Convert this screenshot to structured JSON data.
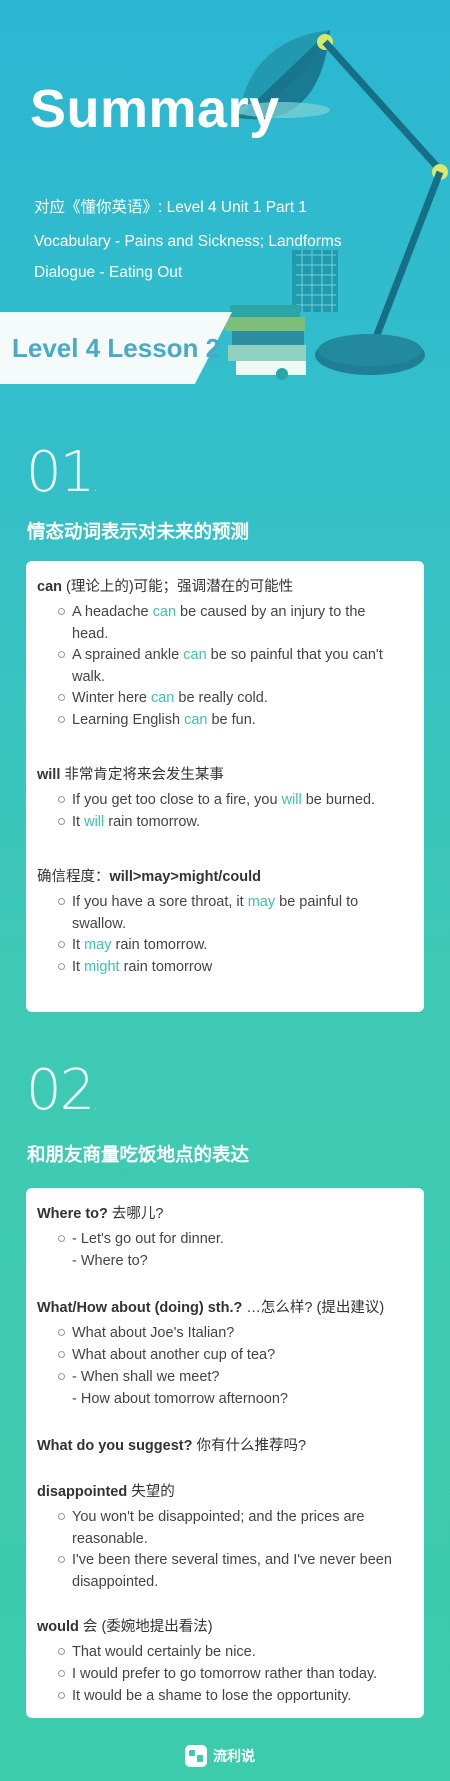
{
  "header": {
    "title": "Summary",
    "reference": "对应《懂你英语》: Level 4 Unit 1 Part 1",
    "line1": "Vocabulary - Pains and Sickness; Landforms",
    "line2": "Dialogue - Eating Out",
    "lesson": "Level 4 Lesson 2"
  },
  "section1": {
    "number": "01",
    "dot": ".",
    "title": "情态动词表示对未来的预测",
    "groups": [
      {
        "heading_en": "can",
        "heading_cn": " (理论上的)可能；强调潜在的可能性",
        "items": [
          {
            "a": "A headache ",
            "hl": "can",
            "b": " be caused by an injury to the",
            "c": "head."
          },
          {
            "a": "A sprained ankle ",
            "hl": "can",
            "b": " be so painful that you can't",
            "c": "walk."
          },
          {
            "a": "Winter here ",
            "hl": "can",
            "b": " be really cold."
          },
          {
            "a": "Learning English ",
            "hl": "can",
            "b": " be fun."
          }
        ]
      },
      {
        "heading_en": "will",
        "heading_cn": " 非常肯定将来会发生某事",
        "items": [
          {
            "a": "If you get too close to a fire, you ",
            "hl": "will",
            "b": " be burned."
          },
          {
            "a": "It ",
            "hl": "will",
            "b": " rain tomorrow."
          }
        ]
      },
      {
        "heading_en": "will>may>might/could",
        "heading_cn": "确信程度：",
        "items": [
          {
            "a": "If you have a sore throat, it ",
            "hl": "may",
            "b": " be painful to",
            "c": "swallow."
          },
          {
            "a": "It ",
            "hl": "may",
            "b": " rain tomorrow."
          },
          {
            "a": "It ",
            "hl": "might",
            "b": " rain tomorrow"
          }
        ]
      }
    ]
  },
  "section2": {
    "number": "02",
    "dot": ".",
    "title": "和朋友商量吃饭地点的表达",
    "groups": [
      {
        "heading_en": "Where to?",
        "heading_cn": " 去哪儿?",
        "items": [
          {
            "text": "- Let's go out for dinner.",
            "text2": "- Where to?"
          }
        ]
      },
      {
        "heading_en": "What/How about (doing) sth.?",
        "heading_cn": " …怎么样? (提出建议)",
        "items": [
          {
            "text": "What about Joe's Italian?"
          },
          {
            "text": "What about another cup of tea?"
          },
          {
            "text": "- When shall we meet?",
            "text2": "- How about tomorrow afternoon?"
          }
        ]
      },
      {
        "heading_en": "What do you suggest?",
        "heading_cn": " 你有什么推荐吗?",
        "items": []
      },
      {
        "heading_en": "disappointed",
        "heading_cn": " 失望的",
        "items": [
          {
            "text": "You won't be disappointed; and the prices are",
            "text2": "reasonable."
          },
          {
            "text": "I've been there several times, and I've never been",
            "text2": "disappointed."
          }
        ]
      },
      {
        "heading_en": "would",
        "heading_cn": "  会 (委婉地提出看法)",
        "items": [
          {
            "text": "That would certainly be nice."
          },
          {
            "text": "I would prefer to go tomorrow rather than today."
          },
          {
            "text": "It would be a shame to lose the opportunity."
          }
        ]
      }
    ]
  },
  "footer": {
    "brand": "流利说"
  },
  "colors": {
    "highlight": "#3cc2b0",
    "lesson_text": "#4aa9c7"
  }
}
